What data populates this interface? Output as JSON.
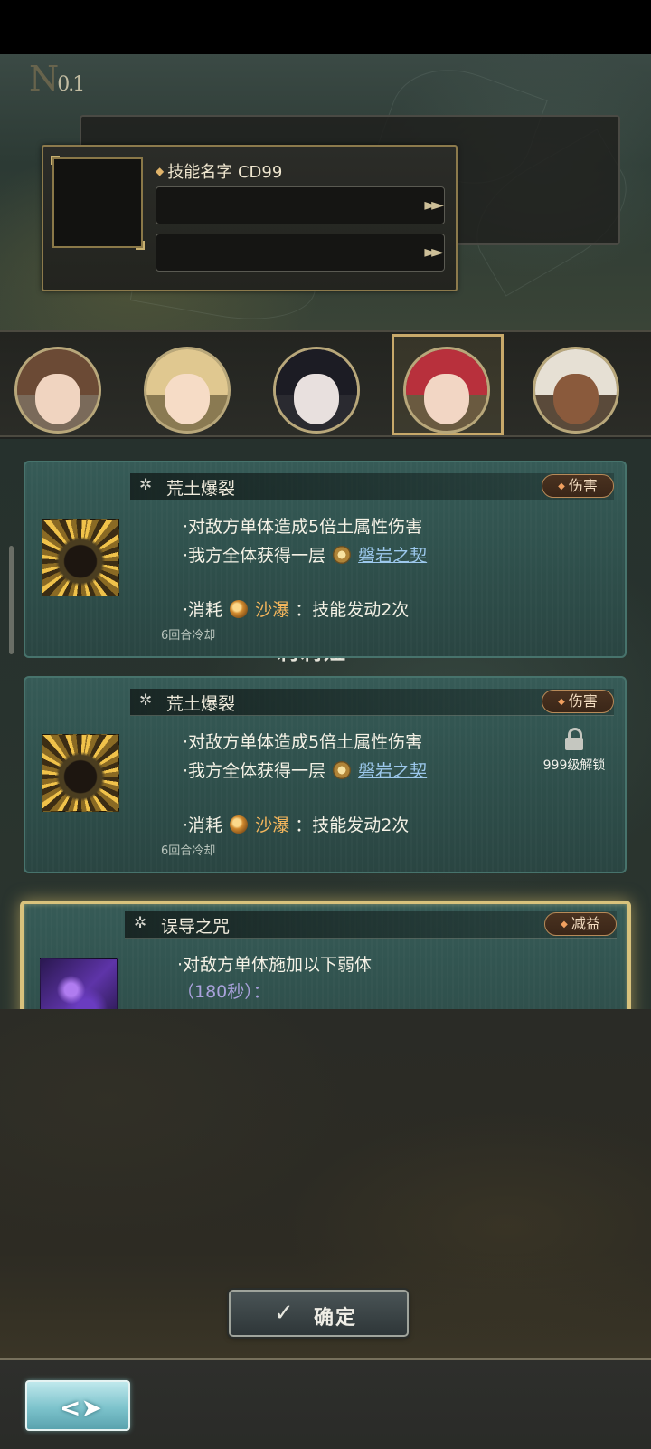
{
  "header": {
    "slot_number": "0.1",
    "slot_prefix": "N"
  },
  "skill_preview": {
    "name": "技能名字",
    "cd": "CD99",
    "bar_arrow_icon": "double-chevron-right-icon"
  },
  "portraits": [
    {
      "name": "portrait-1",
      "hair": "#6b4a35",
      "face": "#f0d4c0",
      "selected": false
    },
    {
      "name": "portrait-2",
      "hair": "#e0c890",
      "face": "#f6dcc6",
      "selected": false
    },
    {
      "name": "portrait-3",
      "hair": "#1c1c24",
      "face": "#e8e0de",
      "selected": false
    },
    {
      "name": "portrait-4",
      "hair": "#b8303c",
      "face": "#f2d6c4",
      "selected": true
    },
    {
      "name": "portrait-5",
      "hair": "#e6e0d4",
      "face": "#8a5a3c",
      "selected": false
    }
  ],
  "cards": [
    {
      "title": "荒土爆裂",
      "tag": "伤害",
      "line1": "·对敌方单体造成5倍土属性伤害",
      "line2_prefix": "·我方全体获得一层",
      "line2_link": "磐岩之契",
      "line3_prefix": "·消耗",
      "line3_resource": "沙瀑",
      "line3_suffix": "：技能发动2次",
      "cooldown": "6回合冷却"
    },
    {
      "title": "荒土爆裂",
      "tag": "伤害",
      "line1": "·对敌方单体造成5倍土属性伤害",
      "line2_prefix": "·我方全体获得一层",
      "line2_link": "磐岩之契",
      "line3_prefix": "·消耗",
      "line3_resource": "沙瀑",
      "line3_suffix": "：技能发动2次",
      "cooldown": "6回合冷却",
      "lock_text": "999级解锁"
    },
    {
      "title": "误导之咒",
      "tag": "减益",
      "line1": "·对敌方单体施加以下弱体",
      "line2": "（180秒）："
    }
  ],
  "behind_text": "莉莉娅",
  "buttons": {
    "confirm": "确定",
    "confirm_icon": "check-icon",
    "back_icon": "back-arrow-icon"
  },
  "colors": {
    "gold_frame": "#c8a96a",
    "card_teal": "#365b57",
    "link_blue": "#9cc8ec",
    "resource_orange": "#f2b55c",
    "back_button_cyan": "#7dc3cc"
  }
}
